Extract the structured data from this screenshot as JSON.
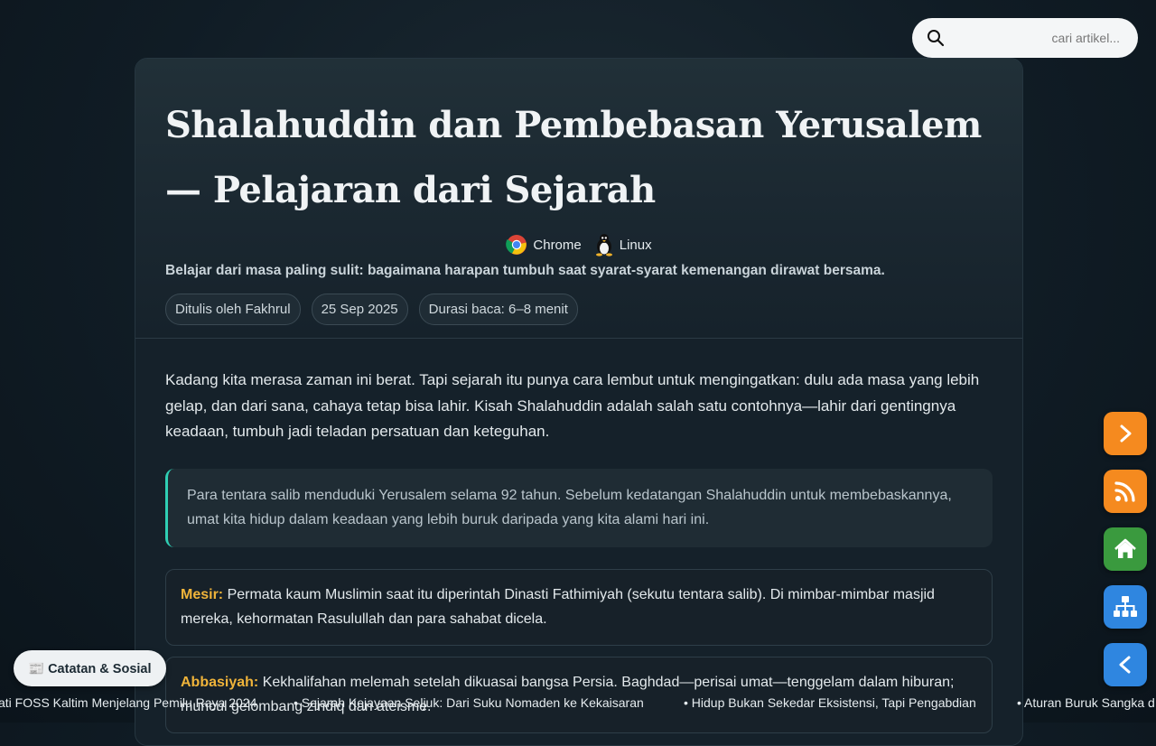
{
  "search": {
    "placeholder": "cari artikel..."
  },
  "article": {
    "title": "Shalahuddin dan Pembebasan Yerusalem — Pelajaran dari Sejarah",
    "badges": [
      {
        "label": "Chrome",
        "icon": "chrome-icon"
      },
      {
        "label": "Linux",
        "icon": "linux-tux-icon"
      }
    ],
    "subtitle": "Belajar dari masa paling sulit: bagaimana harapan tumbuh saat syarat-syarat kemenangan dirawat bersama.",
    "meta": {
      "author": "Ditulis oleh Fakhrul",
      "date": "25 Sep 2025",
      "read_time": "Durasi baca: 6–8 menit"
    },
    "lead": "Kadang kita merasa zaman ini berat. Tapi sejarah itu punya cara lembut untuk mengingatkan: dulu ada masa yang lebih gelap, dan dari sana, cahaya tetap bisa lahir. Kisah Shalahuddin adalah salah satu contohnya—lahir dari gentingnya keadaan, tumbuh jadi teladan persatuan dan keteguhan.",
    "quote": "Para tentara salib menduduki Yerusalem selama 92 tahun. Sebelum kedatangan Shalahuddin untuk membebaskannya, umat kita hidup dalam keadaan yang lebih buruk daripada yang kita alami hari ini.",
    "boxes": [
      {
        "key": "Mesir:",
        "text": " Permata kaum Muslimin saat itu diperintah Dinasti Fathimiyah (sekutu tentara salib). Di mimbar-mimbar masjid mereka, kehormatan Rasulullah dan para sahabat dicela."
      },
      {
        "key": "Abbasiyah:",
        "text": " Kekhalifahan melemah setelah dikuasai bangsa Persia. Baghdad—perisai umat—tenggelam dalam hiburan; muncul gelombang zindiq dan ateisme."
      }
    ]
  },
  "side_buttons": [
    {
      "name": "next-button",
      "icon": "chevron-right-icon",
      "color": "#f58a1f"
    },
    {
      "name": "rss-button",
      "icon": "rss-icon",
      "color": "#f58a1f"
    },
    {
      "name": "home-button",
      "icon": "home-icon",
      "color": "#3a9a3e"
    },
    {
      "name": "sitemap-button",
      "icon": "sitemap-icon",
      "color": "#2f86e0"
    },
    {
      "name": "back-button",
      "icon": "chevron-left-icon",
      "color": "#2f86e0"
    }
  ],
  "catatan": {
    "label": "📰 Catatan & Sosial"
  },
  "ticker": [
    "ati FOSS Kaltim Menjelang Pemilu Raya 2024",
    "• Sejarah Kejayaan Seljuk: Dari Suku Nomaden ke Kekaisaran",
    "• Hidup Bukan Sekedar Eksistensi, Tapi Pengabdian",
    "• Aturan Buruk Sangka d"
  ]
}
